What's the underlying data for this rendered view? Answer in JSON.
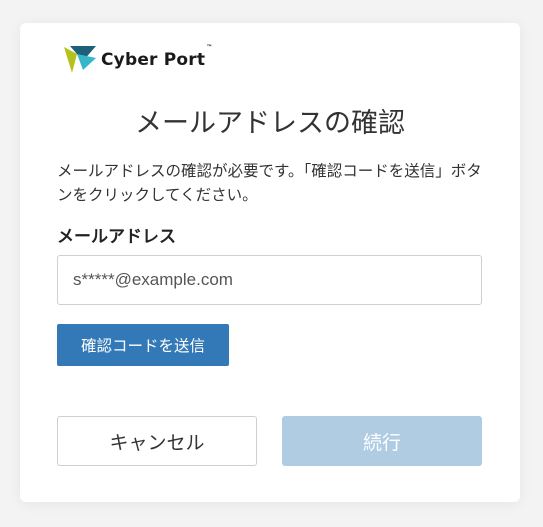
{
  "brand": {
    "name": "Cyber Port",
    "trademark": "™",
    "logo_colors": {
      "green": "#b5c21b",
      "dark_teal": "#1e5f7a",
      "cyan": "#36b7c9"
    }
  },
  "page": {
    "title": "メールアドレスの確認",
    "description": "メールアドレスの確認が必要です。「確認コードを送信」ボタンをクリックしてください。"
  },
  "form": {
    "email_label": "メールアドレス",
    "email_value": "s*****@example.com"
  },
  "buttons": {
    "send_code": "確認コードを送信",
    "cancel": "キャンセル",
    "continue": "続行"
  },
  "colors": {
    "primary": "#3479b7",
    "disabled_primary": "#b0cce3",
    "background": "#f3f3f3",
    "card": "#ffffff"
  }
}
